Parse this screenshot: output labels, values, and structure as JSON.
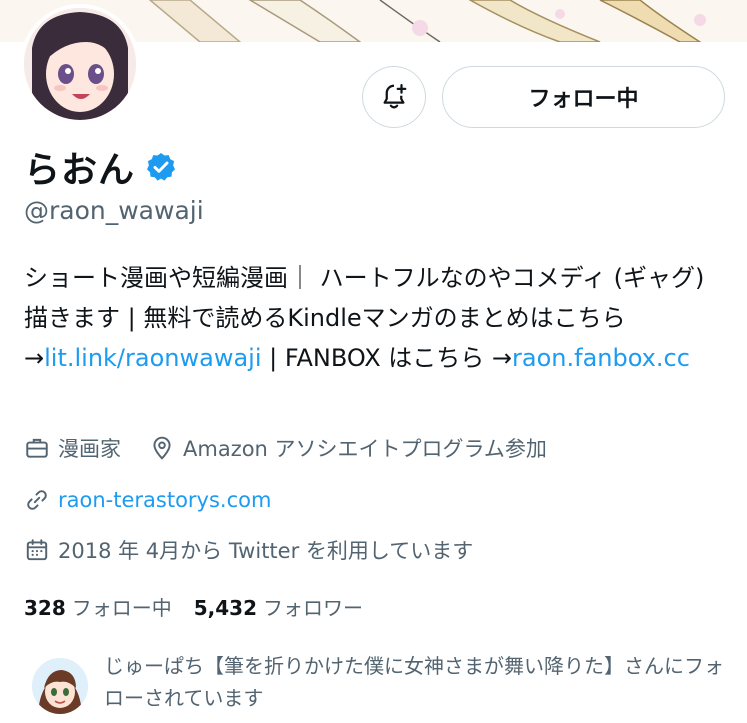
{
  "profile": {
    "display_name": "らおん",
    "handle": "@raon_wawaji",
    "verified": true,
    "follow_button_label": "フォロー中",
    "bio": {
      "text1": "ショート漫画や短編漫画｜ ハートフルなのやコメディ (ギャグ) 描きます | 無料で読めるKindleマンガのまとめはこちら →",
      "link1": "lit.link/raonwawaji",
      "text2": " | FANBOX はこちら →",
      "link2": "raon.fanbox.cc"
    },
    "category": "漫画家",
    "location": "Amazon アソシエイトプログラム参加",
    "website": "raon-terastorys.com",
    "joined": "2018 年 4月から Twitter を利用しています",
    "following_count": "328",
    "following_label": "フォロー中",
    "followers_count": "5,432",
    "followers_label": "フォロワー",
    "followed_by_text": "じゅーぱち【筆を折りかけた僕に女神さまが舞い降りた】さんにフォローされています"
  },
  "colors": {
    "accent": "#1d9bf0",
    "text": "#0f1419",
    "secondary": "#536471",
    "border": "#cfd9de"
  },
  "icons": {
    "notify": "bell-plus-icon",
    "verified": "verified-badge-icon",
    "category": "briefcase-icon",
    "location": "location-pin-icon",
    "website": "link-icon",
    "joined": "calendar-icon"
  }
}
